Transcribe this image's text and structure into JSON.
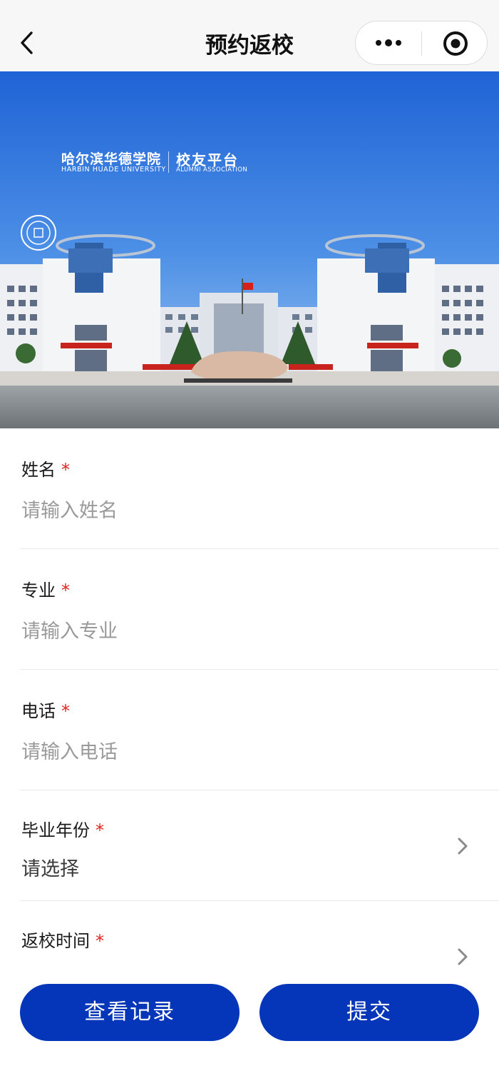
{
  "nav": {
    "title": "预约返校",
    "back_icon": "chevron-left-icon",
    "more_icon": "more-dots-icon",
    "target_icon": "target-circle-icon"
  },
  "banner": {
    "school_name_cn": "哈尔滨华德学院",
    "school_name_en": "HARBIN HUADE UNIVERSITY",
    "platform_cn": "校友平台",
    "platform_en": "ALUMNI ASSOCIATION"
  },
  "form": {
    "name": {
      "label": "姓名",
      "required": "*",
      "placeholder": "请输入姓名"
    },
    "major": {
      "label": "专业",
      "required": "*",
      "placeholder": "请输入专业"
    },
    "phone": {
      "label": "电话",
      "required": "*",
      "placeholder": "请输入电话"
    },
    "grad_year": {
      "label": "毕业年份",
      "required": "*",
      "value": "请选择"
    },
    "return_time": {
      "label": "返校时间",
      "required": "*"
    }
  },
  "actions": {
    "view_records": "查看记录",
    "submit": "提交"
  },
  "colors": {
    "primary": "#0535b8",
    "required": "#e2231a",
    "placeholder": "#9a9a9a"
  }
}
